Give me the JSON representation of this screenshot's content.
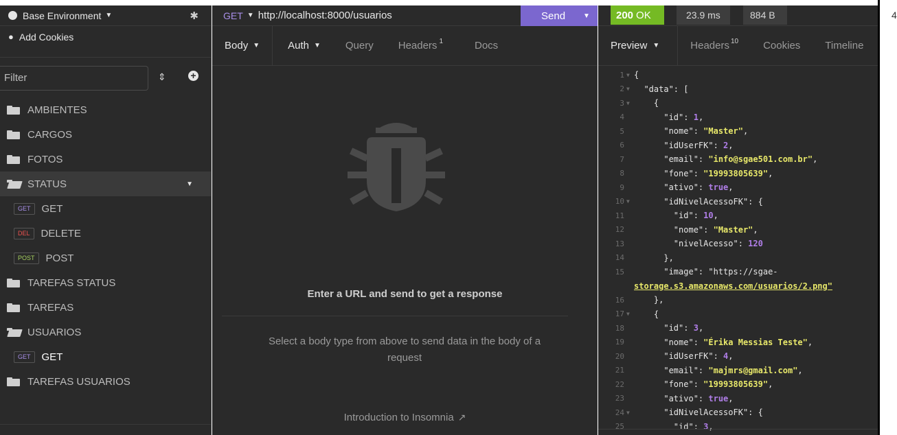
{
  "sidebar": {
    "environment": "Base Environment",
    "cookies": "Add Cookies",
    "filter_placeholder": "Filter",
    "items": [
      {
        "type": "folder",
        "label": "AMBIENTES"
      },
      {
        "type": "folder",
        "label": "CARGOS"
      },
      {
        "type": "folder",
        "label": "FOTOS"
      },
      {
        "type": "folder",
        "label": "STATUS",
        "open": true
      },
      {
        "type": "request",
        "method": "GET",
        "label": "GET"
      },
      {
        "type": "request",
        "method": "DEL",
        "label": "DELETE"
      },
      {
        "type": "request",
        "method": "POST",
        "label": "POST"
      },
      {
        "type": "folder",
        "label": "TAREFAS STATUS"
      },
      {
        "type": "folder",
        "label": "TAREFAS"
      },
      {
        "type": "folder",
        "label": "USUARIOS",
        "open": true
      },
      {
        "type": "request",
        "method": "GET",
        "label": "GET",
        "selected": true
      },
      {
        "type": "folder",
        "label": "TAREFAS USUARIOS"
      }
    ]
  },
  "request": {
    "method": "GET",
    "url": "http://localhost:8000/usuarios",
    "send_label": "Send",
    "tabs": {
      "body": "Body",
      "auth": "Auth",
      "query": "Query",
      "headers": "Headers",
      "headers_count": "1",
      "docs": "Docs"
    },
    "empty_title": "Enter a URL and send to get a response",
    "empty_sub": "Select a body type from above to send data in the body of a request",
    "intro_link": "Introduction to Insomnia"
  },
  "response": {
    "status_code": "200",
    "status_text": "OK",
    "time": "23.9 ms",
    "size": "884 B",
    "tabs": {
      "preview": "Preview",
      "headers": "Headers",
      "headers_count": "10",
      "cookies": "Cookies",
      "timeline": "Timeline"
    },
    "lines": [
      {
        "n": "1",
        "fold": true,
        "code": "{"
      },
      {
        "n": "2",
        "fold": true,
        "code": "  \"data\": ["
      },
      {
        "n": "3",
        "fold": true,
        "code": "    {"
      },
      {
        "n": "4",
        "code": "      \"id\": 1,"
      },
      {
        "n": "5",
        "code": "      \"nome\": \"Master\","
      },
      {
        "n": "6",
        "code": "      \"idUserFK\": 2,"
      },
      {
        "n": "7",
        "code": "      \"email\": \"info@sgae501.com.br\","
      },
      {
        "n": "8",
        "code": "      \"fone\": \"19993805639\","
      },
      {
        "n": "9",
        "code": "      \"ativo\": true,"
      },
      {
        "n": "10",
        "fold": true,
        "code": "      \"idNivelAcessoFK\": {"
      },
      {
        "n": "11",
        "code": "        \"id\": 10,"
      },
      {
        "n": "12",
        "code": "        \"nome\": \"Master\","
      },
      {
        "n": "13",
        "code": "        \"nivelAcesso\": 120"
      },
      {
        "n": "14",
        "code": "      },"
      },
      {
        "n": "15",
        "code": "      \"image\": \"https://sgae-"
      },
      {
        "n": "",
        "code": "storage.s3.amazonaws.com/usuarios/2.png\""
      },
      {
        "n": "16",
        "code": "    },"
      },
      {
        "n": "17",
        "fold": true,
        "code": "    {"
      },
      {
        "n": "18",
        "code": "      \"id\": 3,"
      },
      {
        "n": "19",
        "code": "      \"nome\": \"Érika Messias Teste\","
      },
      {
        "n": "20",
        "code": "      \"idUserFK\": 4,"
      },
      {
        "n": "21",
        "code": "      \"email\": \"majmrs@gmail.com\","
      },
      {
        "n": "22",
        "code": "      \"fone\": \"19993805639\","
      },
      {
        "n": "23",
        "code": "      \"ativo\": true,"
      },
      {
        "n": "24",
        "fold": true,
        "code": "      \"idNivelAcessoFK\": {"
      },
      {
        "n": "25",
        "code": "        \"id\": 3,"
      }
    ]
  },
  "edge_text": "4",
  "colors": {
    "accent": "#7b67cf",
    "ok": "#75ba24",
    "get": "#a88fe8",
    "del": "#ef5350",
    "post": "#a5cf5f"
  }
}
